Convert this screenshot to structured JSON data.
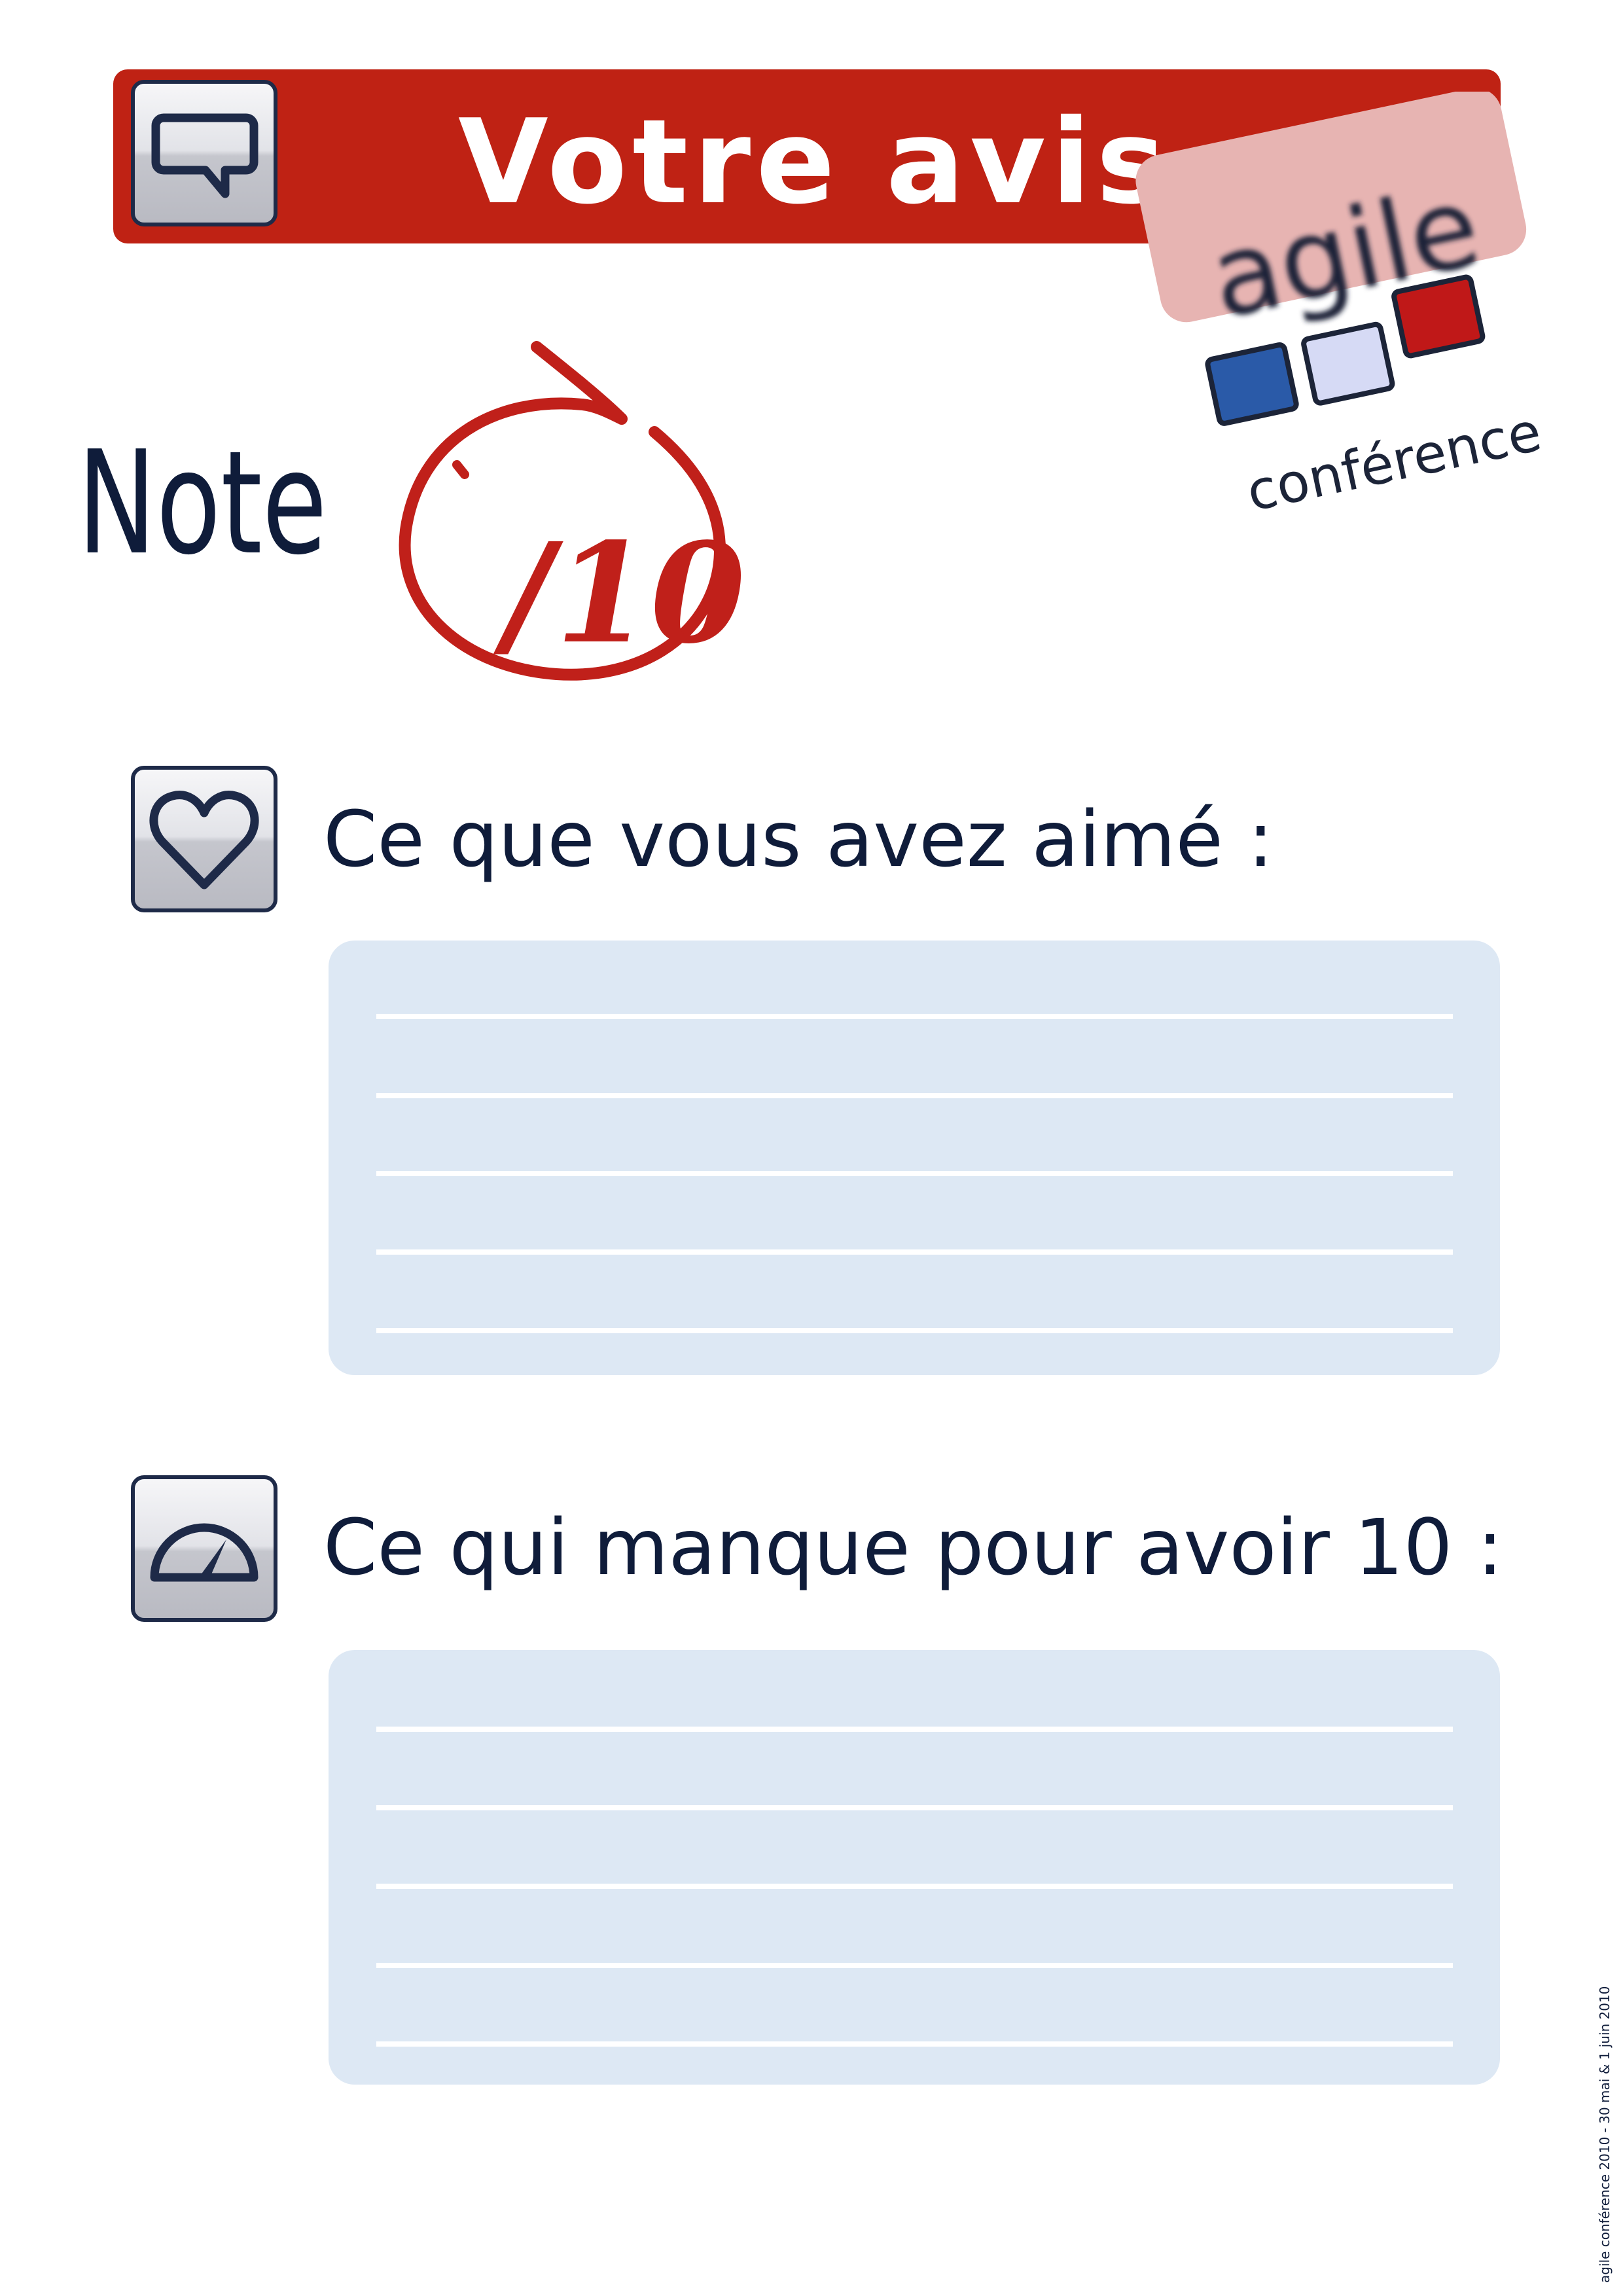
{
  "header": {
    "title": "Votre avis",
    "icon": "speech-bubble-icon",
    "background_color": "#bf2214"
  },
  "logo": {
    "word": "agile",
    "subword": "conférence",
    "square_colors": [
      "#2a5aa8",
      "#d6daf5",
      "#c01818"
    ]
  },
  "note": {
    "label": "Note",
    "scale": "/10",
    "mark_color": "#c0201a"
  },
  "sections": [
    {
      "heading": "Ce que vous avez aimé :",
      "icon": "heart-icon",
      "lines": 5
    },
    {
      "heading": "Ce qui manque pour avoir 10 :",
      "icon": "gauge-icon",
      "lines": 5
    }
  ],
  "footer": {
    "text": "agile conférence 2010 - 30 mai & 1 juin 2010"
  },
  "colors": {
    "text": "#0f1c3a",
    "answer_area": "#dde8f4",
    "accent": "#bf2214"
  }
}
